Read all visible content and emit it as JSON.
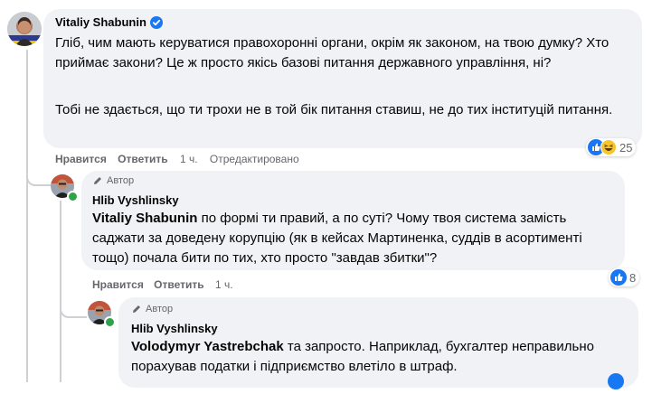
{
  "comment1": {
    "author": "Vitaliy Shabunin",
    "verified": true,
    "paragraph1": "Гліб, чим мають керуватися правохоронні органи, окрім як законом, на твою думку? Хто приймає закони? Це ж просто якісь базові питання державного управління, ні?",
    "paragraph2": "Тобі не здається, що ти трохи не в той бік питання ставиш, не до тих інституцій питання.",
    "like_label": "Нравится",
    "reply_label": "Ответить",
    "time": "1 ч.",
    "edited_label": "Отредактировано",
    "reaction_count": "25"
  },
  "reply1": {
    "badge": "Автор",
    "author": "Hlib Vyshlinsky",
    "mention": "Vitaliy Shabunin",
    "text": " по формі ти правий, а по суті? Чому твоя система замість саджати за доведену корупцію (як в кейсах Мартиненка, суддів в асортименті тощо) почала бити по тих, хто просто \"завдав збитки\"?",
    "like_label": "Нравится",
    "reply_label": "Ответить",
    "time": "1 ч.",
    "reaction_count": "8"
  },
  "reply2": {
    "badge": "Автор",
    "author": "Hlib Vyshlinsky",
    "mention": "Volodymyr Yastrebchak",
    "text": " та запросто. Наприклад, бухгалтер неправильно порахував податки і підприємство влетіло в штраф."
  },
  "colors": {
    "like_blue": "#1877f2",
    "bubble": "#f0f2f5",
    "secondary_text": "#65676b",
    "online": "#31a24c"
  }
}
